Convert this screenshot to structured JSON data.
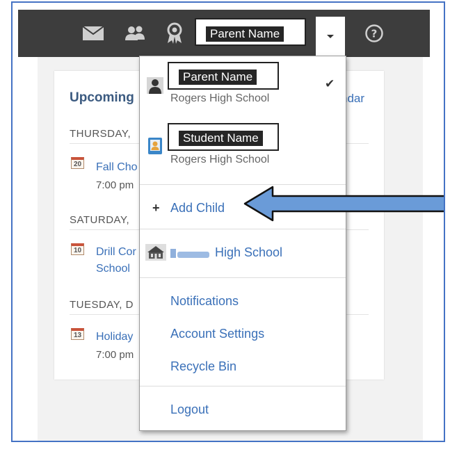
{
  "topbar": {
    "parent_name": "Parent Name",
    "icons": [
      "mail-icon",
      "people-icon",
      "badge-icon",
      "chevron-down-icon",
      "help-icon"
    ]
  },
  "card": {
    "title": "Upcoming",
    "calendar_link": "ndar",
    "days": [
      {
        "header": "THURSDAY,",
        "event_day": "20",
        "event_title": "Fall Cho",
        "event_time": "7:00 pm"
      },
      {
        "header": "SATURDAY,",
        "event_day": "10",
        "event_title_line1": "Drill Cor",
        "event_title_line2": "School"
      },
      {
        "header": "TUESDAY, D",
        "event_day": "13",
        "event_title": "Holiday",
        "event_time": "7:00 pm"
      }
    ]
  },
  "menu": {
    "parent": {
      "name": "Parent Name",
      "school": "Rogers High School",
      "check": "✔"
    },
    "student": {
      "name": "Student Name",
      "school": "Rogers High School"
    },
    "add_child": {
      "plus": "+",
      "label": "Add Child"
    },
    "school_link": "High School",
    "notifications": "Notifications",
    "account_settings": "Account Settings",
    "recycle_bin": "Recycle Bin",
    "logout": "Logout"
  },
  "colors": {
    "frame_border": "#4472c4",
    "topbar": "#3d3d3d",
    "link": "#3a70b8",
    "arrow_fill": "#6a9bd8"
  }
}
